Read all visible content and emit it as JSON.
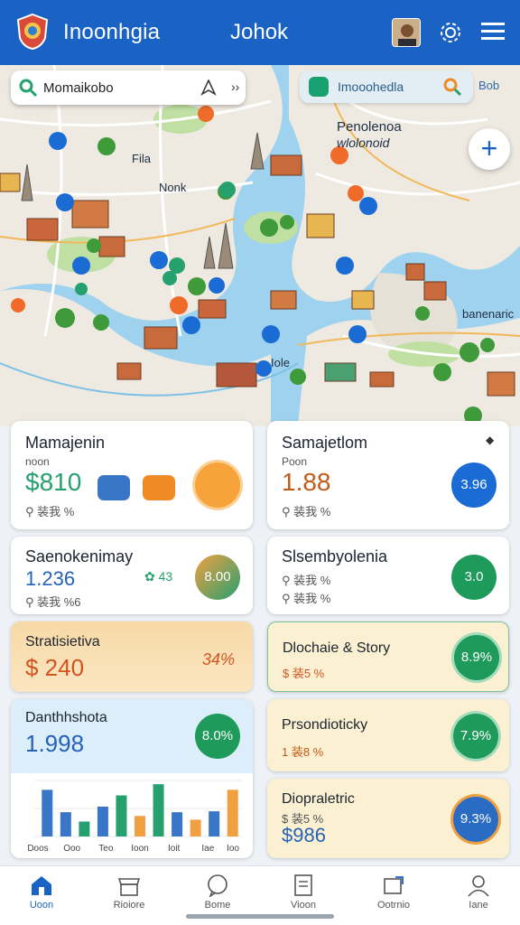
{
  "header": {
    "app_title": "Inoonhgia",
    "title": "Johok",
    "icons": [
      "crest-logo-icon",
      "avatar",
      "gear-icon",
      "menu-icon"
    ]
  },
  "map": {
    "search_value": "Momaikobo",
    "quick_search_value": "Imooohedla",
    "extra_label": "Bob",
    "fab_label": "+",
    "labels": {
      "top_left": "Fila",
      "center": "Nonk",
      "right_title": "Penolenoa",
      "right_sub": "wlolonoid",
      "bottom": "Iole",
      "far_right": "banenaric"
    }
  },
  "cards": {
    "c1": {
      "title": "Mamajenin",
      "sub": "noon",
      "value": "$810",
      "meta": "⚲ 装我 %"
    },
    "c2": {
      "title": "Samajetlom",
      "sub": "Poon",
      "value": "1.88",
      "meta": "⚲ 装我 %",
      "circle": "3.96"
    },
    "c3": {
      "title": "Saenokenimay",
      "value": "1.236",
      "meta": "⚲ 装我 %6",
      "circle": "8.00",
      "stat": "43"
    },
    "c4": {
      "title": "Slsembyolenia",
      "value": "",
      "meta1": "⚲ 装我 %",
      "meta2": "⚲ 装我 %",
      "circle": "3.0"
    },
    "c5": {
      "title": "Stratisietiva",
      "value": "$ 240",
      "side": "34%"
    },
    "c6": {
      "title": "Dlochaie & Story",
      "meta": "$ 装5 %",
      "circle": "8.9%"
    },
    "c7": {
      "title": "Danthhshota",
      "value": "1.998",
      "circle": "8.0%"
    },
    "c8": {
      "title": "Prsondioticky",
      "meta": "1 装8 %",
      "circle": "7.9%"
    },
    "c9": {
      "title": "Diopraletric",
      "meta": "$ 装5 %",
      "value": "$986",
      "circle": "9.3%"
    }
  },
  "chart_data": {
    "type": "bar",
    "categories": [
      "Doos",
      "Ooo",
      "Teo",
      "Ioon",
      "Ioit",
      "Iae",
      "Ioo"
    ],
    "series": [
      {
        "values": [
          5,
          2.6,
          1.6,
          3.2,
          4.4,
          2.2,
          5.6,
          2.6,
          1.8,
          2.7,
          5
        ]
      }
    ],
    "colors": [
      "#3a76c8",
      "#3a76c8",
      "#27a070",
      "#3a76c8",
      "#27a070",
      "#f0a040",
      "#27a070",
      "#3a76c8",
      "#f0a040",
      "#3a76c8",
      "#f0a040"
    ]
  },
  "nav": {
    "items": [
      {
        "label": "Uoon",
        "icon": "home-icon"
      },
      {
        "label": "Rioiore",
        "icon": "store-icon"
      },
      {
        "label": "Bome",
        "icon": "chat-icon"
      },
      {
        "label": "Vioon",
        "icon": "document-icon"
      },
      {
        "label": "Ootrnio",
        "icon": "share-icon"
      },
      {
        "label": "Iane",
        "icon": "profile-icon"
      }
    ]
  },
  "colors": {
    "primary": "#1a63c4",
    "green": "#27a070",
    "orange": "#f08a24",
    "peach": "#f6d9a6",
    "cream": "#fbf1d2",
    "sky": "#dbeefa"
  }
}
